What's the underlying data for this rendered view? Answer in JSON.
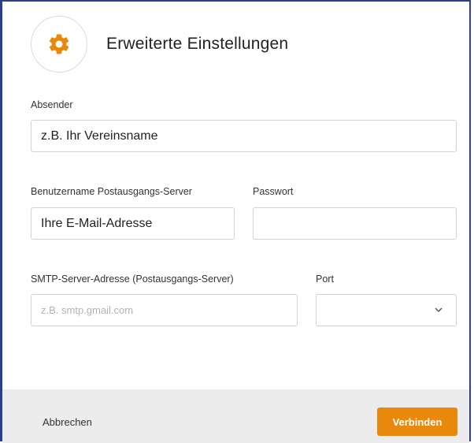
{
  "dialog": {
    "title": "Erweiterte Einstellungen",
    "icon": "gear-icon",
    "accent_color": "#e8890c",
    "border_color": "#2c3e8f"
  },
  "fields": {
    "sender": {
      "label": "Absender",
      "value": "z.B. Ihr Vereinsname"
    },
    "smtp_user": {
      "label": "Benutzername Postausgangs-Server",
      "value": "Ihre E-Mail-Adresse"
    },
    "password": {
      "label": "Passwort",
      "value": ""
    },
    "smtp_server": {
      "label": "SMTP-Server-Adresse (Postausgangs-Server)",
      "placeholder": "z.B. smtp.gmail.com"
    },
    "port": {
      "label": "Port",
      "value": "",
      "icon": "chevron-down-icon"
    }
  },
  "footer": {
    "cancel_label": "Abbrechen",
    "connect_label": "Verbinden"
  }
}
